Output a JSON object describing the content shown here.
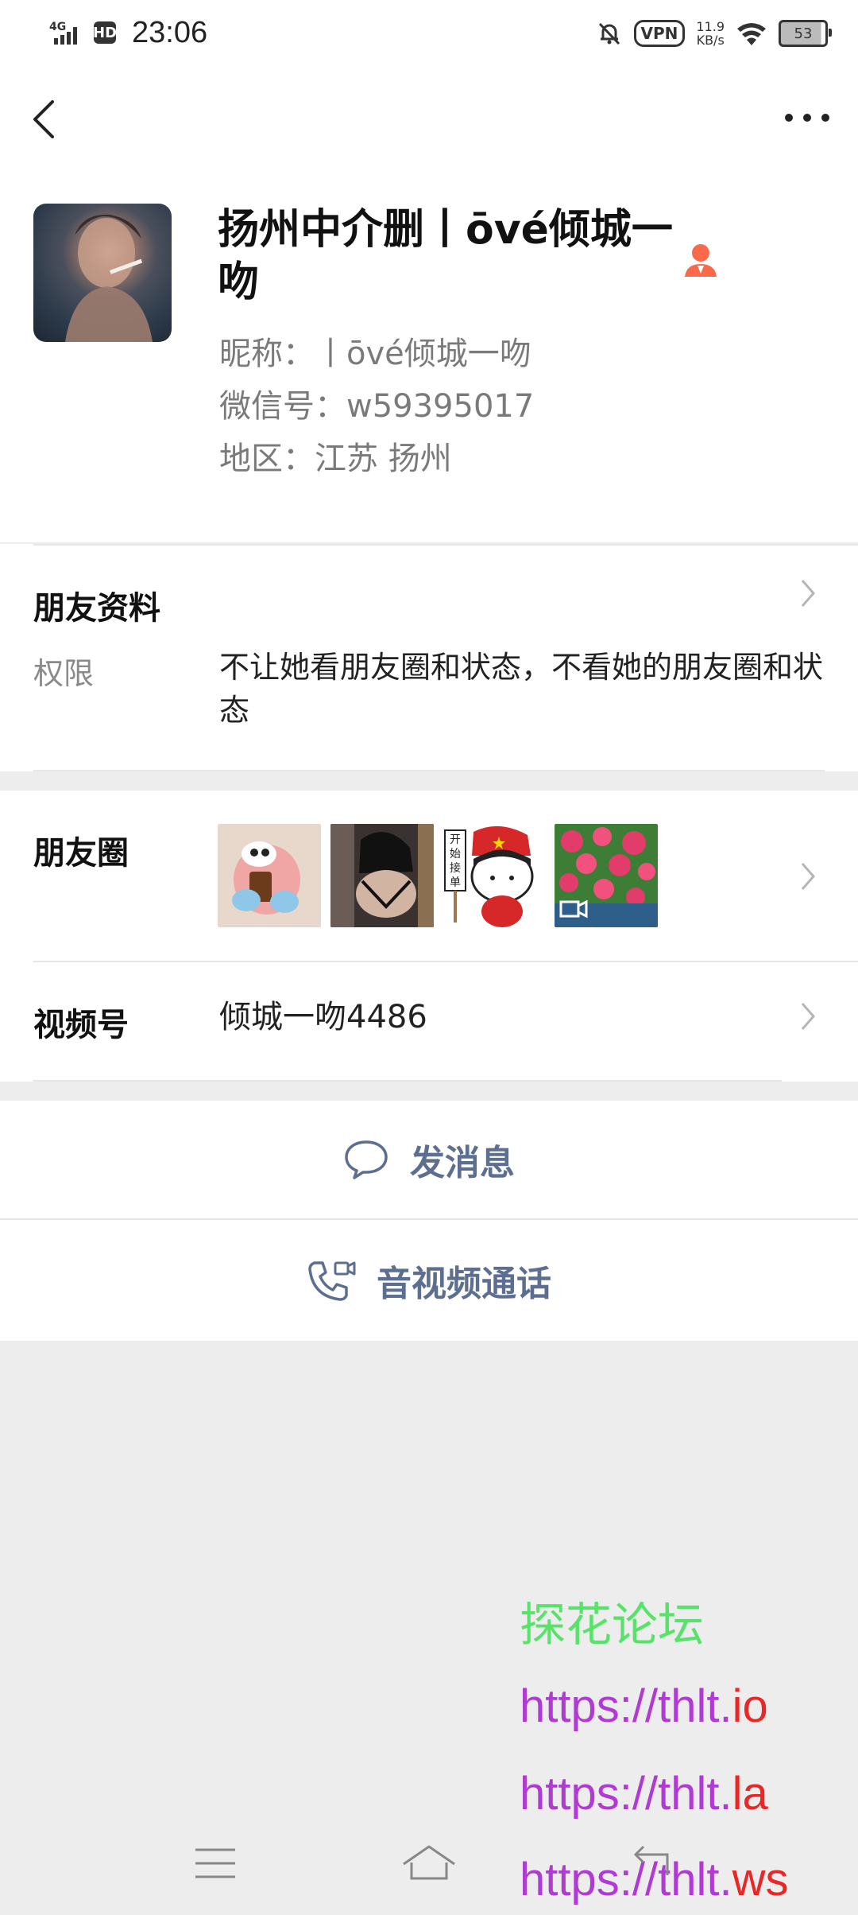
{
  "status_bar": {
    "network": "4G",
    "hd": "HD",
    "time": "23:06",
    "vpn": "VPN",
    "speed_value": "11.9",
    "speed_unit": "KB/s",
    "battery": "53"
  },
  "profile": {
    "display_name": "扬州中介删丨ōvé倾城一吻",
    "nickname": "昵称：丨ōvé倾城一吻",
    "wechat_id": "微信号：w59395017",
    "region": "地区：江苏  扬州"
  },
  "friend_profile": {
    "title": "朋友资料",
    "permission_label": "权限",
    "permission_value": "不让她看朋友圈和状态，不看她的朋友圈和状态"
  },
  "moments": {
    "label": "朋友圈",
    "thumbs": [
      "pink-toy-photo",
      "woman-photo",
      "sticker-开始接单",
      "rose-video"
    ],
    "sticker_text": "开始接单"
  },
  "channels": {
    "label": "视频号",
    "value": "倾城一吻4486"
  },
  "actions": {
    "message": "发消息",
    "call": "音视频通话"
  },
  "watermark": {
    "line1": "探花论坛",
    "line2_prefix": "https://thlt.",
    "line2_suffix": "io",
    "line3_prefix": "https://thlt.",
    "line3_suffix": "la",
    "line4_prefix": "https://thlt.",
    "line4_suffix": "ws"
  },
  "colors": {
    "accent_blue": "#5d6f91",
    "contact_icon": "#fa6a4a",
    "watermark_green": "#57e36a",
    "watermark_purple": "#b03ad3",
    "watermark_red": "#ea2727"
  }
}
